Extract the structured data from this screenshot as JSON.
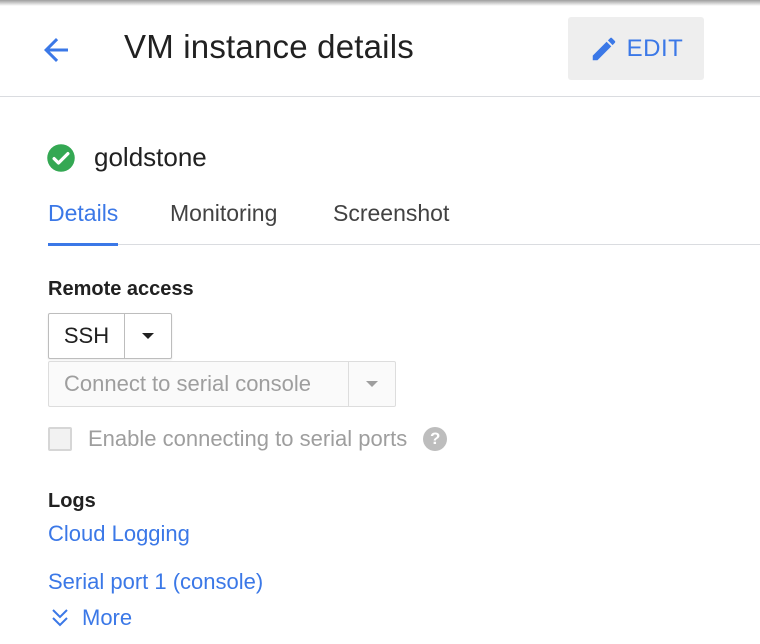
{
  "header": {
    "back_icon": "arrow-back-icon",
    "title": "VM instance details",
    "edit_icon": "pencil-icon",
    "edit_label": "EDIT"
  },
  "instance": {
    "status_icon": "check-circle-icon",
    "status_color": "#34a853",
    "name": "goldstone"
  },
  "tabs": [
    {
      "label": "Details",
      "active": true
    },
    {
      "label": "Monitoring",
      "active": false
    },
    {
      "label": "Screenshot",
      "active": false
    }
  ],
  "remote_access": {
    "heading": "Remote access",
    "ssh_label": "SSH",
    "serial_console_label": "Connect to serial console",
    "serial_ports_checkbox_label": "Enable connecting to serial ports",
    "serial_ports_checked": false,
    "help_icon": "help-icon"
  },
  "logs": {
    "heading": "Logs",
    "links": [
      "Cloud Logging",
      "Serial port 1 (console)"
    ],
    "more_label": "More",
    "more_icon": "double-chevron-down-icon"
  },
  "colors": {
    "accent": "#3b78e7",
    "text": "#212121",
    "disabled_text": "#9e9e9e",
    "button_bg": "#eeeeee"
  }
}
